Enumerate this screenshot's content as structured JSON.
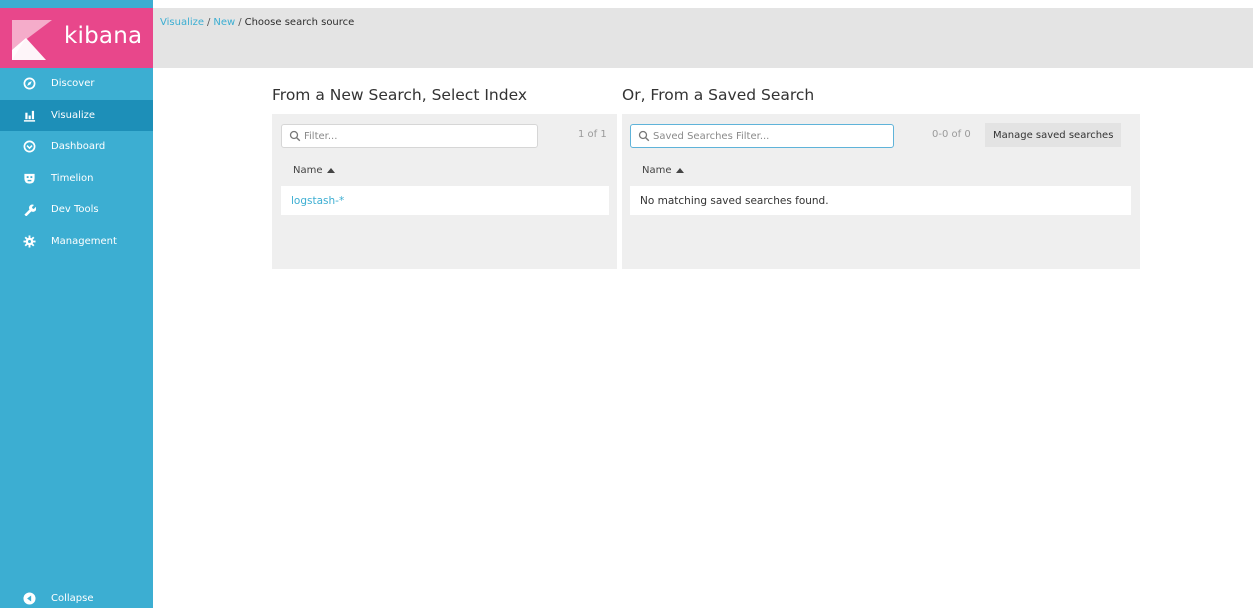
{
  "brand": {
    "name": "kibana"
  },
  "sidebar": {
    "items": [
      {
        "label": "Discover",
        "icon": "compass-icon"
      },
      {
        "label": "Visualize",
        "icon": "bar-chart-icon",
        "active": true
      },
      {
        "label": "Dashboard",
        "icon": "dashboard-icon"
      },
      {
        "label": "Timelion",
        "icon": "timelion-icon"
      },
      {
        "label": "Dev Tools",
        "icon": "wrench-icon"
      },
      {
        "label": "Management",
        "icon": "gear-icon"
      }
    ],
    "collapse_label": "Collapse"
  },
  "breadcrumb": {
    "items": [
      "Visualize",
      "New",
      "Choose search source"
    ],
    "separator": "/"
  },
  "new_search": {
    "title": "From a New Search, Select Index",
    "filter_placeholder": "Filter...",
    "count": "1 of 1",
    "column_header": "Name",
    "rows": [
      "logstash-*"
    ]
  },
  "saved_search": {
    "title": "Or, From a Saved Search",
    "filter_placeholder": "Saved Searches Filter...",
    "count": "0-0 of 0",
    "manage_label": "Manage saved searches",
    "column_header": "Name",
    "empty_message": "No matching saved searches found."
  },
  "colors": {
    "sidebar": "#3caed2",
    "sidebar_active": "#1d8fb8",
    "brand": "#e8478b",
    "link": "#3caed2"
  }
}
